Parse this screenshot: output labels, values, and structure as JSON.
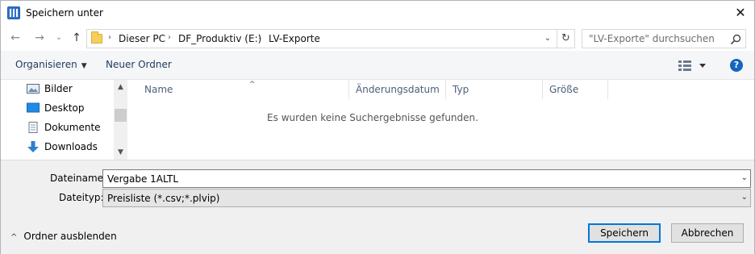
{
  "window": {
    "title": "Speichern unter",
    "close_symbol": "✕",
    "icon": "app-window-icon"
  },
  "nav": {
    "back": "←",
    "forward": "→",
    "recent": "⌄",
    "up": "↑",
    "breadcrumb": [
      "Dieser PC",
      "DF_Produktiv (E:)",
      "LV-Exporte"
    ],
    "separator": "›",
    "dropdown": "⌄",
    "refresh": "↻",
    "search_placeholder": "\"LV-Exporte\" durchsuchen"
  },
  "toolbar": {
    "organize": "Organisieren",
    "new_folder": "Neuer Ordner",
    "help": "?"
  },
  "sidebar": {
    "items": [
      {
        "label": "Bilder",
        "icon": "pictures-icon"
      },
      {
        "label": "Desktop",
        "icon": "desktop-icon"
      },
      {
        "label": "Dokumente",
        "icon": "documents-icon"
      },
      {
        "label": "Downloads",
        "icon": "downloads-icon"
      }
    ]
  },
  "filelist": {
    "columns": [
      "Name",
      "Änderungsdatum",
      "Typ",
      "Größe"
    ],
    "empty_message": "Es wurden keine Suchergebnisse gefunden."
  },
  "form": {
    "filename_label": "Dateiname:",
    "filename_value": "Vergabe 1ALTL",
    "filetype_label": "Dateityp:",
    "filetype_value": "Preisliste (*.csv;*.plvip)"
  },
  "footer": {
    "hide_folders": "Ordner ausblenden",
    "save": "Speichern",
    "cancel": "Abbrechen"
  },
  "colors": {
    "accent": "#0078d7",
    "help_icon": "#1565c0",
    "folder": "#f5cf5a"
  }
}
